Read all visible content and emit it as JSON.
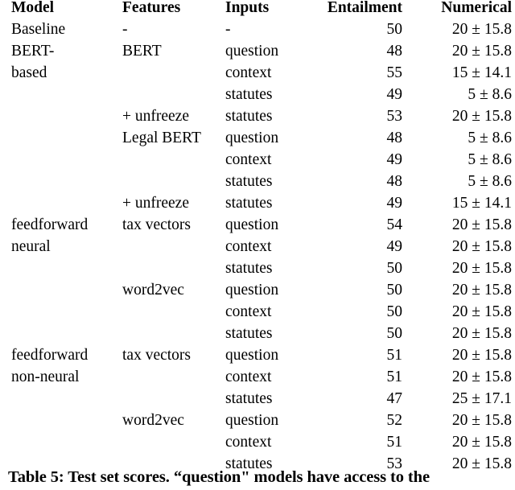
{
  "table": {
    "label": "Table 5",
    "columns": [
      "Model",
      "Features",
      "Inputs",
      "Entailment",
      "Numerical"
    ],
    "header": {
      "model": "Model",
      "features": "Features",
      "inputs": "Inputs",
      "entailment": "Entailment",
      "numerical": "Numerical"
    },
    "sections": [
      {
        "name": "baseline",
        "rows": [
          {
            "model": "Baseline",
            "features": "-",
            "inputs": "-",
            "entailment": "50",
            "numerical": "20 ± 15.8"
          }
        ]
      },
      {
        "name": "bert-based",
        "rows": [
          {
            "model": "BERT-",
            "features": "BERT",
            "inputs": "question",
            "entailment": "48",
            "numerical": "20 ± 15.8"
          },
          {
            "model": "based",
            "features": "",
            "inputs": "context",
            "entailment": "55",
            "numerical": "15 ± 14.1"
          },
          {
            "model": "",
            "features": "",
            "inputs": "statutes",
            "entailment": "49",
            "numerical": "5 ± 8.6"
          },
          {
            "model": "",
            "features": "+ unfreeze",
            "inputs": "statutes",
            "entailment": "53",
            "numerical": "20 ± 15.8"
          },
          {
            "model": "",
            "features": "Legal BERT",
            "inputs": "question",
            "entailment": "48",
            "numerical": "5 ± 8.6"
          },
          {
            "model": "",
            "features": "",
            "inputs": "context",
            "entailment": "49",
            "numerical": "5 ± 8.6"
          },
          {
            "model": "",
            "features": "",
            "inputs": "statutes",
            "entailment": "48",
            "numerical": "5 ± 8.6"
          },
          {
            "model": "",
            "features": "+ unfreeze",
            "inputs": "statutes",
            "entailment": "49",
            "numerical": "15 ± 14.1"
          }
        ]
      },
      {
        "name": "feedforward-neural",
        "rows": [
          {
            "model": "feedforward",
            "features": "tax vectors",
            "inputs": "question",
            "entailment": "54",
            "numerical": "20 ± 15.8"
          },
          {
            "model": "neural",
            "features": "",
            "inputs": "context",
            "entailment": "49",
            "numerical": "20 ± 15.8"
          },
          {
            "model": "",
            "features": "",
            "inputs": "statutes",
            "entailment": "50",
            "numerical": "20 ± 15.8"
          },
          {
            "model": "",
            "features": "word2vec",
            "inputs": "question",
            "entailment": "50",
            "numerical": "20 ± 15.8"
          },
          {
            "model": "",
            "features": "",
            "inputs": "context",
            "entailment": "50",
            "numerical": "20 ± 15.8"
          },
          {
            "model": "",
            "features": "",
            "inputs": "statutes",
            "entailment": "50",
            "numerical": "20 ± 15.8"
          }
        ]
      },
      {
        "name": "feedforward-non-neural",
        "rows": [
          {
            "model": "feedforward",
            "features": "tax vectors",
            "inputs": "question",
            "entailment": "51",
            "numerical": "20 ± 15.8"
          },
          {
            "model": "non-neural",
            "features": "",
            "inputs": "context",
            "entailment": "51",
            "numerical": "20 ± 15.8"
          },
          {
            "model": "",
            "features": "",
            "inputs": "statutes",
            "entailment": "47",
            "numerical": "25 ± 17.1"
          },
          {
            "model": "",
            "features": "word2vec",
            "inputs": "question",
            "entailment": "52",
            "numerical": "20 ± 15.8"
          },
          {
            "model": "",
            "features": "",
            "inputs": "context",
            "entailment": "51",
            "numerical": "20 ± 15.8"
          },
          {
            "model": "",
            "features": "",
            "inputs": "statutes",
            "entailment": "53",
            "numerical": "20 ± 15.8"
          }
        ]
      }
    ]
  },
  "caption": {
    "text": "Table 5: Test set scores. “question\" models have access to the"
  }
}
